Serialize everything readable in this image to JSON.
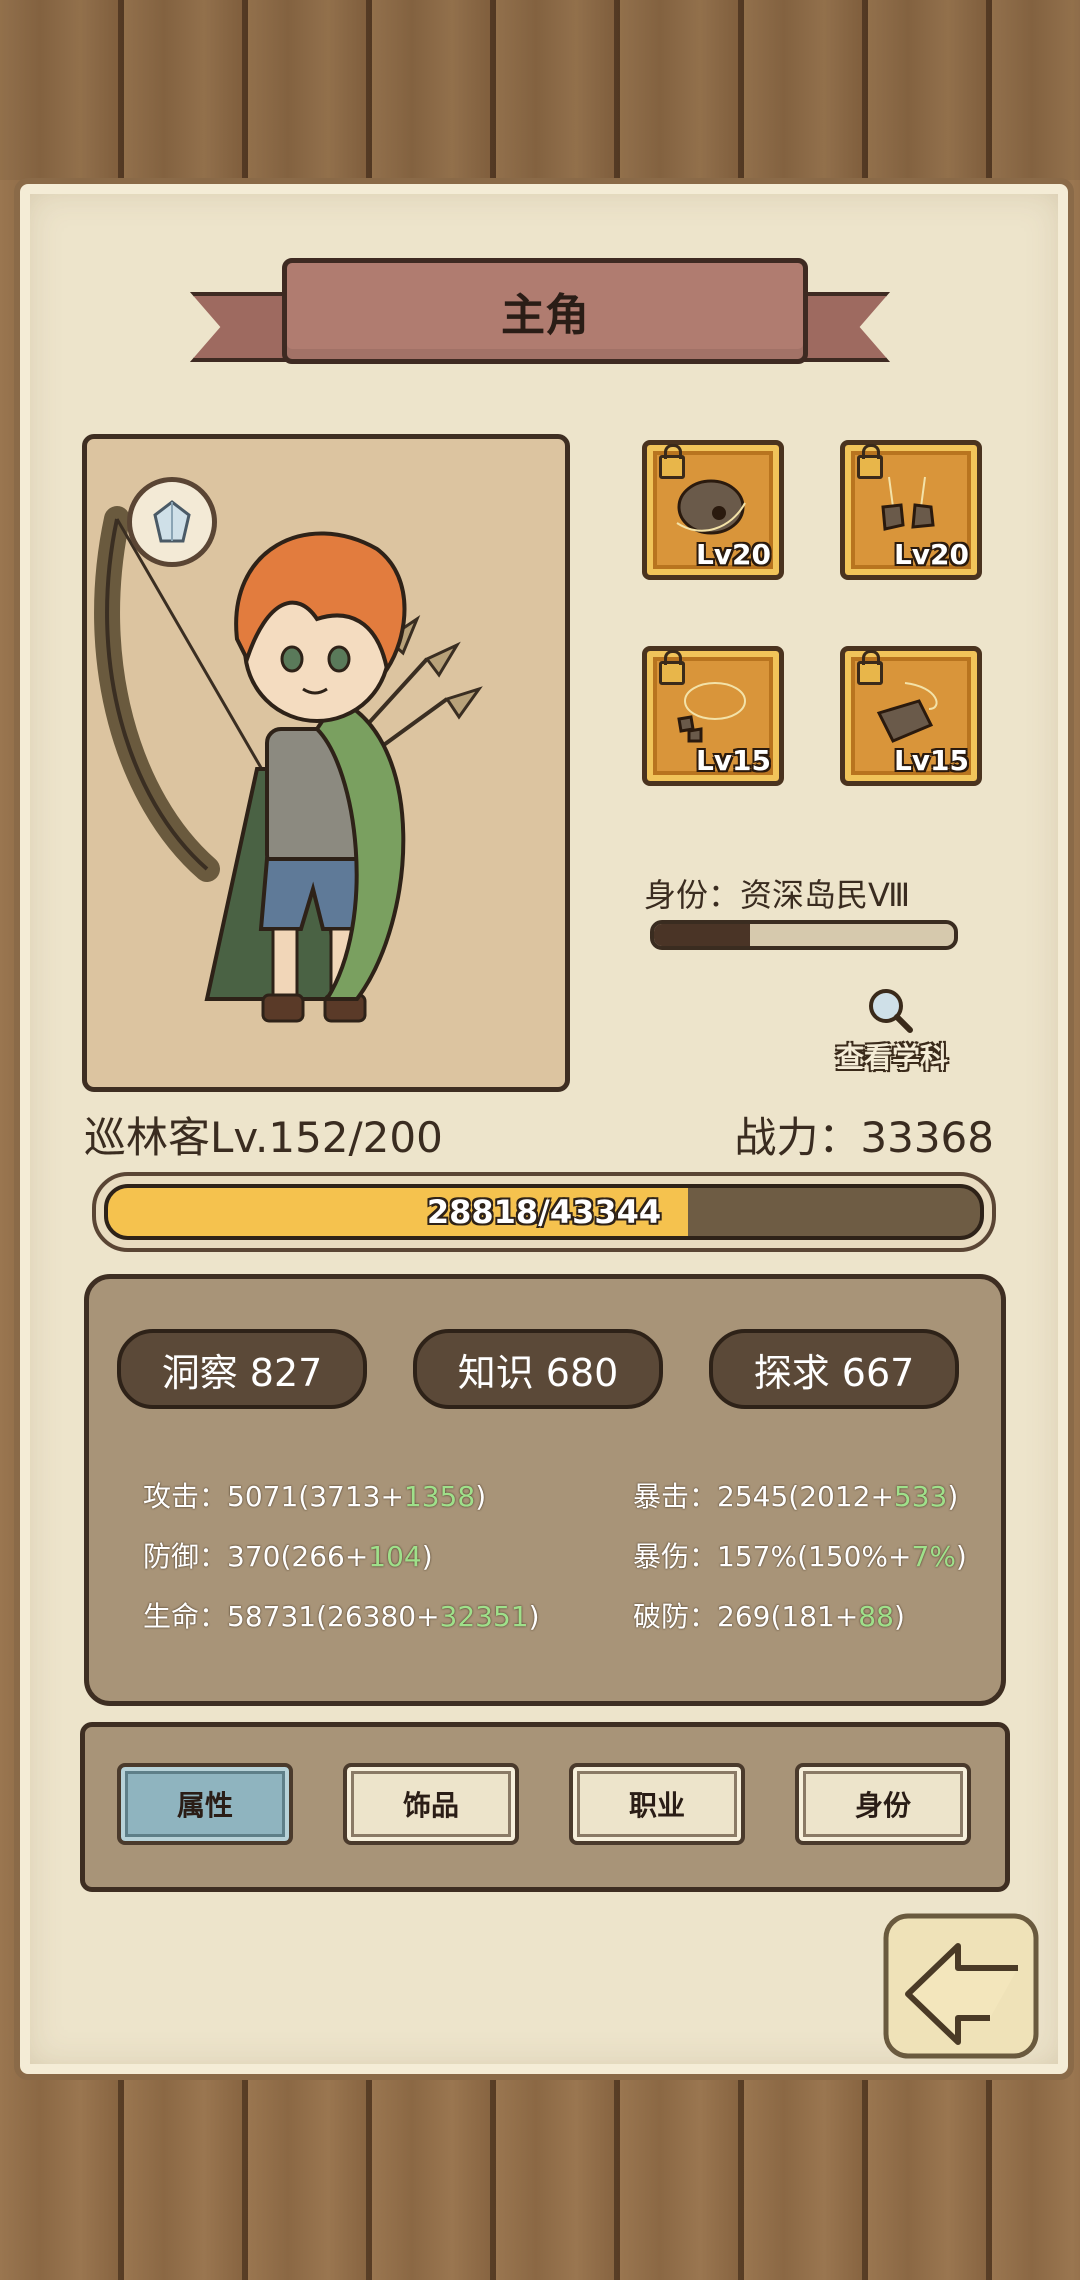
{
  "header": {
    "title": "主角"
  },
  "equipment": [
    {
      "level": "Lv20"
    },
    {
      "level": "Lv20"
    },
    {
      "level": "Lv15"
    },
    {
      "level": "Lv15"
    }
  ],
  "identity": {
    "label": "身份：资深岛民Ⅷ",
    "progress": 0.32
  },
  "lookup": {
    "label": "查看学科"
  },
  "character": {
    "class_level": "巡林客Lv.152/200",
    "power": "战力：33368"
  },
  "experience": {
    "text": "28818/43344",
    "current": 28818,
    "max": 43344
  },
  "attributes": [
    {
      "label": "洞察 827"
    },
    {
      "label": "知识 680"
    },
    {
      "label": "探求 667"
    }
  ],
  "stats": {
    "attack": {
      "label": "攻击：",
      "total": "5071(3713+",
      "bonus": "1358",
      "end": ")"
    },
    "defense": {
      "label": "防御：",
      "total": "370(266+",
      "bonus": "104",
      "end": ")"
    },
    "hp": {
      "label": "生命：",
      "total": "58731(26380+",
      "bonus": "32351",
      "end": ")"
    },
    "crit": {
      "label": "暴击：",
      "total": "2545(2012+",
      "bonus": "533",
      "end": ")"
    },
    "crit_damage": {
      "label": "暴伤：",
      "total": "157%(150%+",
      "bonus": "7%",
      "end": ")"
    },
    "armor_break": {
      "label": "破防：",
      "total": "269(181+",
      "bonus": "88",
      "end": ")"
    }
  },
  "tabs": [
    {
      "label": "属性",
      "active": true
    },
    {
      "label": "饰品",
      "active": false
    },
    {
      "label": "职业",
      "active": false
    },
    {
      "label": "身份",
      "active": false
    }
  ],
  "colors": {
    "exp_fill": "#f5c24e",
    "bonus_text": "#9fe08a",
    "active_tab": "#8fb4bf"
  }
}
